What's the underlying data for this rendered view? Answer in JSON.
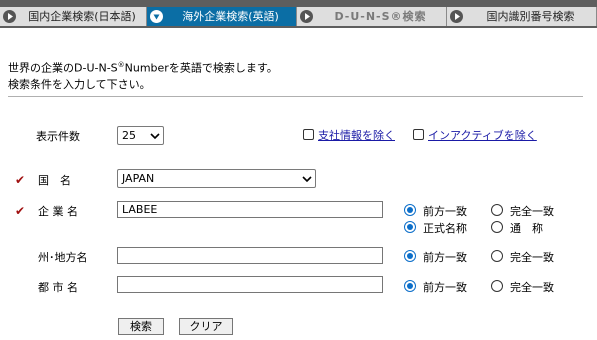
{
  "tabs": [
    {
      "label": "国内企業検索(日本語)",
      "active": false
    },
    {
      "label": "海外企業検索(英語)",
      "active": true
    },
    {
      "label": "D-U-N-S®検索",
      "active": false
    },
    {
      "label": "国内識別番号検索",
      "active": false
    }
  ],
  "intro": {
    "line1_pre": "世界の企業のD-U-N-S",
    "line1_sup": "®",
    "line1_post": "Numberを英語で検索します。",
    "line2": "検索条件を入力して下さい。"
  },
  "display_count": {
    "label": "表示件数",
    "value": "25"
  },
  "options": {
    "exclude_branch": "支社情報を除く",
    "exclude_inactive": "インアクティブを除く"
  },
  "required_mark": "✔",
  "country": {
    "label": "国　名",
    "value": "JAPAN"
  },
  "company": {
    "label": "企 業 名",
    "value": "LABEE",
    "match_prefix": "前方一致",
    "match_exact": "完全一致",
    "name_official": "正式名称",
    "name_common": "通　称"
  },
  "state": {
    "label": "州･地方名",
    "value": "",
    "match_prefix": "前方一致",
    "match_exact": "完全一致"
  },
  "city": {
    "label": "都 市 名",
    "value": "",
    "match_prefix": "前方一致",
    "match_exact": "完全一致"
  },
  "buttons": {
    "search": "検索",
    "clear": "クリア"
  },
  "colors": {
    "tab_active": "#0b6ea5",
    "tab_inactive": "#dedede",
    "tab_bar": "#5e5e5e",
    "required": "#a01010",
    "link": "#1a1aa6"
  }
}
